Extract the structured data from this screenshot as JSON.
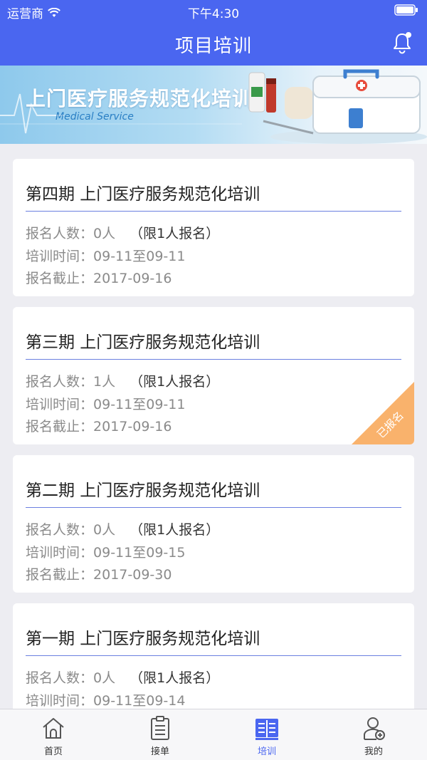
{
  "status_bar": {
    "carrier": "运营商",
    "time": "下午4:30"
  },
  "header": {
    "title": "项目培训"
  },
  "banner": {
    "title": "上门医疗服务规范化培训",
    "subtitle": "Medical Service"
  },
  "trainings": [
    {
      "title": "第四期 上门医疗服务规范化培训",
      "enroll_label": "报名人数：",
      "enroll_value": "0人",
      "limit": "（限1人报名）",
      "time_label": "培训时间：",
      "time_value": "09-11至09-11",
      "deadline_label": "报名截止：",
      "deadline_value": "2017-09-16",
      "badge": ""
    },
    {
      "title": "第三期 上门医疗服务规范化培训",
      "enroll_label": "报名人数：",
      "enroll_value": "1人",
      "limit": "（限1人报名）",
      "time_label": "培训时间：",
      "time_value": "09-11至09-11",
      "deadline_label": "报名截止：",
      "deadline_value": "2017-09-16",
      "badge": "已报名"
    },
    {
      "title": "第二期 上门医疗服务规范化培训",
      "enroll_label": "报名人数：",
      "enroll_value": "0人",
      "limit": "（限1人报名）",
      "time_label": "培训时间：",
      "time_value": "09-11至09-15",
      "deadline_label": "报名截止：",
      "deadline_value": "2017-09-30",
      "badge": ""
    },
    {
      "title": "第一期 上门医疗服务规范化培训",
      "enroll_label": "报名人数：",
      "enroll_value": "0人",
      "limit": "（限1人报名）",
      "time_label": "培训时间：",
      "time_value": "09-11至09-14",
      "deadline_label": "",
      "deadline_value": "",
      "badge": ""
    }
  ],
  "tabbar": {
    "items": [
      {
        "label": "首页",
        "icon": "home-icon"
      },
      {
        "label": "接单",
        "icon": "clipboard-icon"
      },
      {
        "label": "培训",
        "icon": "book-icon",
        "active": true
      },
      {
        "label": "我的",
        "icon": "user-icon"
      }
    ]
  },
  "colors": {
    "primary": "#4a66f0",
    "badge": "#f9b26c"
  }
}
